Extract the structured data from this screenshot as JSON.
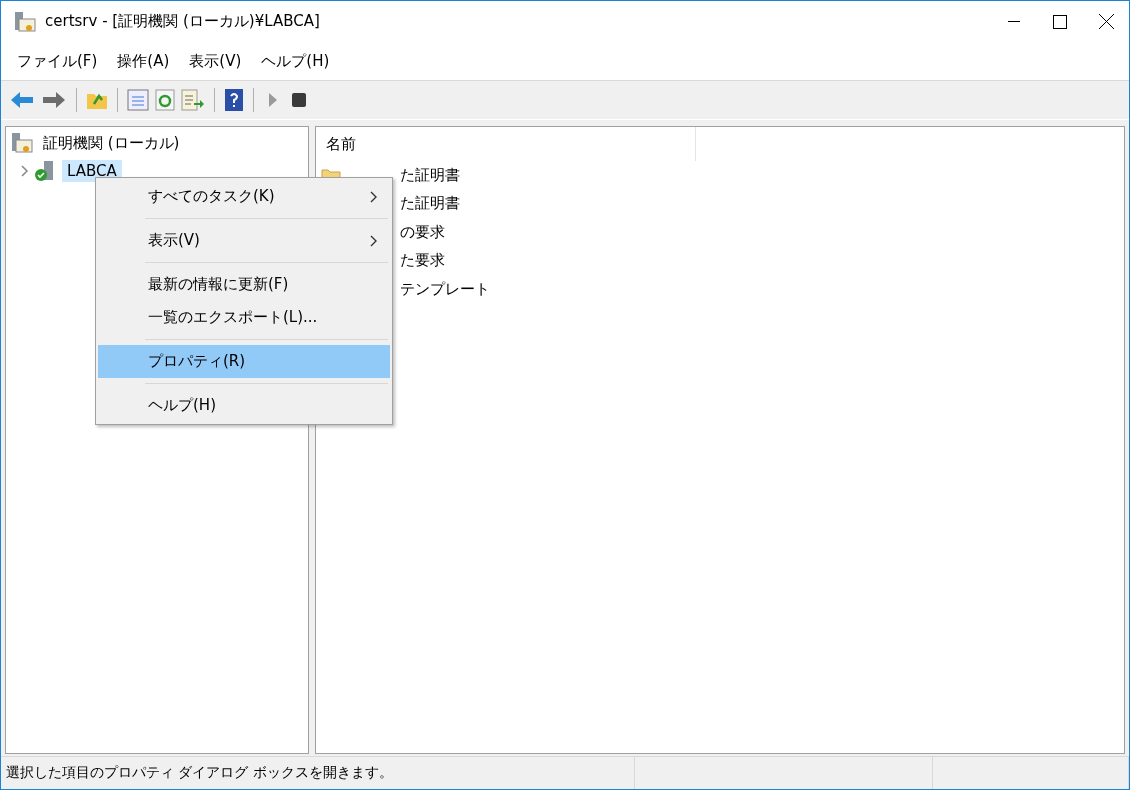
{
  "window": {
    "title": "certsrv - [証明機関 (ローカル)¥LABCA]"
  },
  "menu_bar": [
    "ファイル(F)",
    "操作(A)",
    "表示(V)",
    "ヘルプ(H)"
  ],
  "tree": [
    {
      "label": "証明機関 (ローカル)",
      "selected": false,
      "children": [
        {
          "label": "LABCA",
          "expanded": false,
          "selected": true
        }
      ]
    }
  ],
  "list": {
    "columns": [
      "名前"
    ],
    "rows": [
      "た証明書",
      "た証明書",
      "の要求",
      "た要求",
      "テンプレート"
    ]
  },
  "context_menu": [
    {
      "kind": "item",
      "label": "すべてのタスク(K)",
      "submenu": true,
      "selected": false
    },
    {
      "kind": "separator"
    },
    {
      "kind": "item",
      "label": "表示(V)",
      "submenu": true,
      "selected": false
    },
    {
      "kind": "separator"
    },
    {
      "kind": "item",
      "label": "最新の情報に更新(F)",
      "submenu": false,
      "selected": false
    },
    {
      "kind": "item",
      "label": "一覧のエクスポート(L)...",
      "submenu": false,
      "selected": false
    },
    {
      "kind": "separator"
    },
    {
      "kind": "item",
      "label": "プロパティ(R)",
      "submenu": false,
      "selected": true
    },
    {
      "kind": "separator"
    },
    {
      "kind": "item",
      "label": "ヘルプ(H)",
      "submenu": false,
      "selected": false
    }
  ],
  "status_bar": {
    "text": "選択した項目のプロパティ ダイアログ ボックスを開きます。"
  }
}
